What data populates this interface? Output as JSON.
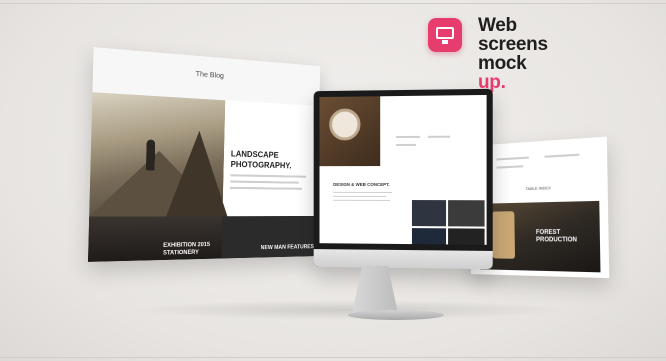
{
  "brand": {
    "icon": "monitor-icon",
    "accent_color": "#e63c6e",
    "line1": "Web",
    "line2": "screens",
    "line3": "mock",
    "line4": "up."
  },
  "left_screen": {
    "header_title": "The Blog",
    "heading": "LANDSCAPE PHOTOGRAPHY.",
    "tile1_label": "EXHIBITION 2015 STATIONERY",
    "tile2_label": "NEW MAN FEATURES"
  },
  "center_screen": {
    "heading": "DESIGN & WEB CONCEPT."
  },
  "right_screen": {
    "header_title": "TABLE INDEX",
    "tile_label": "FOREST PRODUCTION"
  }
}
